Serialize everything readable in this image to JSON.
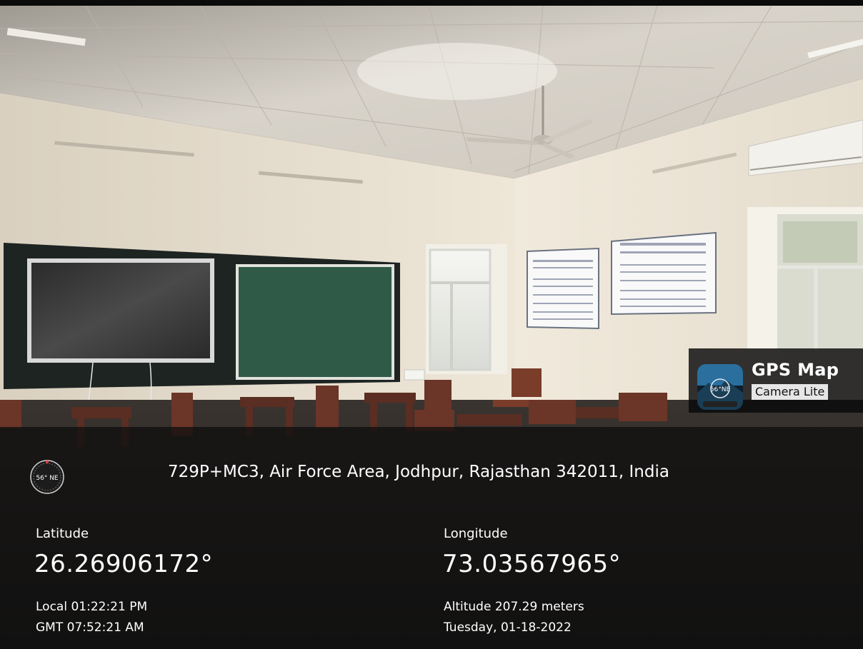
{
  "app_badge": {
    "name": "GPS Map",
    "subtitle": "Camera Lite",
    "icon": "gps-map-camera-app-icon"
  },
  "location": {
    "address": "729P+MC3, Air Force Area, Jodhpur, Rajasthan 342011, India",
    "compass": "56° NE",
    "latitude_label": "Latitude",
    "latitude": "26.26906172°",
    "longitude_label": "Longitude",
    "longitude": "73.03567965°",
    "local_time": "Local 01:22:21 PM",
    "gmt_time": "GMT 07:52:21 AM",
    "altitude": "Altitude 207.29 meters",
    "date": "Tuesday, 01-18-2022"
  },
  "colors": {
    "overlay": "#0e0e0e",
    "text": "#ffffff",
    "wall": "#ece3d3",
    "ceiling": "#dcd6cc",
    "green_board": "#2f5a48",
    "desk_wood": "#5a2e22"
  }
}
